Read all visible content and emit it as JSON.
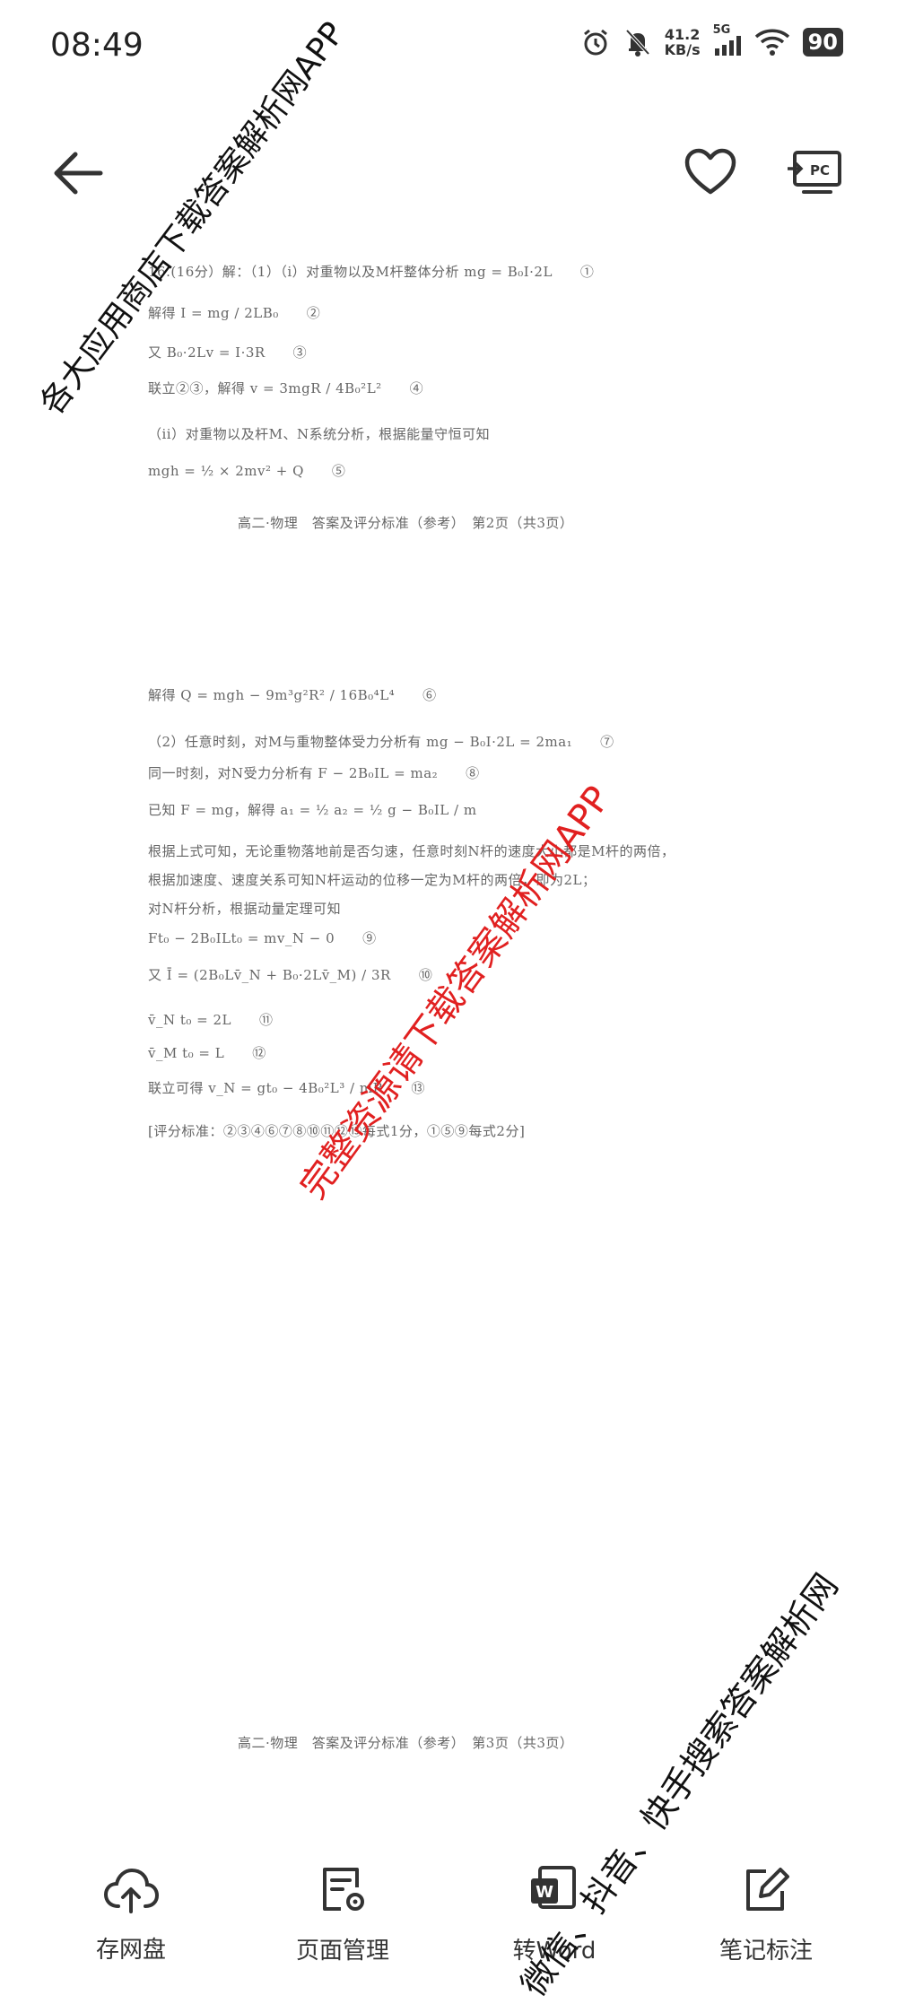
{
  "status_bar": {
    "time": "08:49",
    "net_speed_value": "41.2",
    "net_speed_unit": "KB/s",
    "network_type": "5G",
    "battery": "90",
    "icons": [
      "alarm-icon",
      "mute-icon",
      "signal-icon",
      "wifi-icon",
      "battery-icon"
    ]
  },
  "toolbar": {
    "icons": [
      "back-arrow-icon",
      "heart-icon",
      "pc-cast-icon"
    ],
    "pc_label": "PC"
  },
  "document": {
    "page2_lines": [
      "16.(16分）解：（1）（i）对重物以及M杆整体分析 mg = B₀I·2L　　①",
      "解得 I = mg / 2LB₀　　②",
      "又 B₀·2Lv = I·3R　　③",
      "联立②③，解得 v = 3mgR / 4B₀²L²　　④",
      "（ii）对重物以及杆M、N系统分析，根据能量守恒可知",
      "mgh = ½ × 2mv² + Q　　⑤"
    ],
    "page2_footer": "高二·物理　答案及评分标准（参考）　第2页（共3页）",
    "page3_lines": [
      "解得 Q = mgh − 9m³g²R² / 16B₀⁴L⁴　　⑥",
      "（2）任意时刻，对M与重物整体受力分析有 mg − B₀I·2L = 2ma₁　　⑦",
      "同一时刻，对N受力分析有 F − 2B₀IL = ma₂　　⑧",
      "已知 F = mg，解得 a₁ = ½ a₂ = ½ g − B₀IL / m",
      "根据上式可知，无论重物落地前是否匀速，任意时刻N杆的速度大小都是M杆的两倍，",
      "根据加速度、速度关系可知N杆运动的位移一定为M杆的两倍，即为2L；",
      "对N杆分析，根据动量定理可知",
      "Ft₀ − 2B₀ILt₀ = mv_N − 0　　⑨",
      "又 Ī = (2B₀Lv̄_N + B₀·2Lv̄_M) / 3R　　⑩",
      "v̄_N t₀ = 2L　　⑪",
      "v̄_M t₀ = L　　⑫",
      "联立可得 v_N = gt₀ − 4B₀²L³ / mR　　⑬",
      "[评分标准：②③④⑥⑦⑧⑩⑪⑫⑬每式1分，①⑤⑨每式2分]"
    ],
    "page3_footer": "高二·物理　答案及评分标准（参考）　第3页（共3页）"
  },
  "watermarks": {
    "top_left": "各大应用商店下载答案解析网APP",
    "center": "完整资源请下载答案解析网APP",
    "bottom_right": "微信、抖音、快手搜索答案解析网"
  },
  "bottom_nav": {
    "items": [
      {
        "label": "存网盘",
        "icon": "cloud-upload-icon"
      },
      {
        "label": "页面管理",
        "icon": "page-manage-icon"
      },
      {
        "label": "转Word",
        "icon": "word-icon"
      },
      {
        "label": "笔记标注",
        "icon": "edit-note-icon"
      }
    ]
  }
}
